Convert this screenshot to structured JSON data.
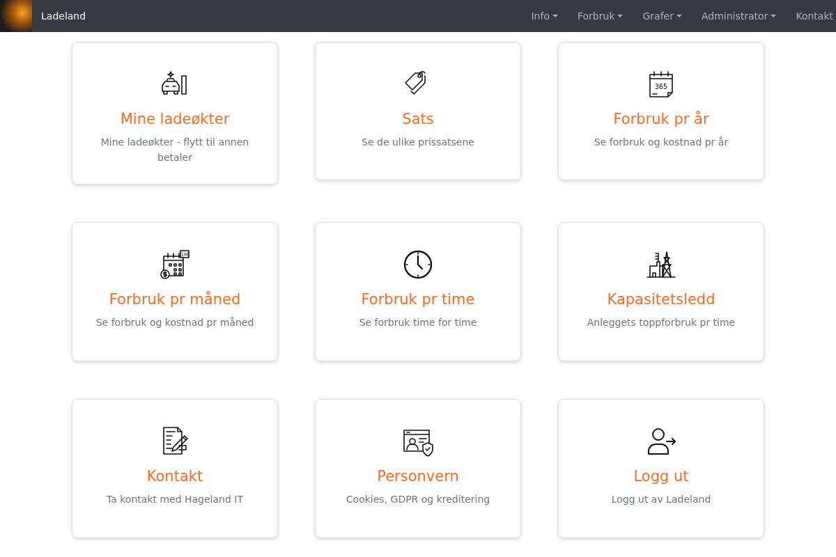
{
  "navbar": {
    "brand": "Ladeland",
    "menu": [
      {
        "label": "Info",
        "dropdown": true
      },
      {
        "label": "Forbruk",
        "dropdown": true
      },
      {
        "label": "Grafer",
        "dropdown": true
      },
      {
        "label": "Administrator",
        "dropdown": true
      },
      {
        "label": "Kontakt",
        "dropdown": false
      }
    ]
  },
  "cards": [
    {
      "kind": "car-charger",
      "title": "Mine ladeøkter",
      "text": "Mine ladeøkter - flytt til annen betaler"
    },
    {
      "kind": "tags",
      "title": "Sats",
      "text": "Se de ulike prissatsene"
    },
    {
      "kind": "calendar-year",
      "icon_text": "365",
      "title": "Forbruk pr år",
      "text": "Se forbruk og kostnad pr år"
    },
    {
      "kind": "calendar-month",
      "icon_text": "1M",
      "title": "Forbruk pr måned",
      "text": "Se forbruk og kostnad pr måned"
    },
    {
      "kind": "clock",
      "title": "Forbruk pr time",
      "text": "Se forbruk time for time"
    },
    {
      "kind": "power-plant",
      "title": "Kapasitetsledd",
      "text": "Anleggets toppforbruk pr time"
    },
    {
      "kind": "document-pen",
      "title": "Kontakt",
      "text": "Ta kontakt med Hageland IT"
    },
    {
      "kind": "profile-shield",
      "title": "Personvern",
      "text": "Cookies, GDPR og kreditering"
    },
    {
      "kind": "user-logout",
      "title": "Logg ut",
      "text": "Logg ut av Ladeland"
    }
  ]
}
